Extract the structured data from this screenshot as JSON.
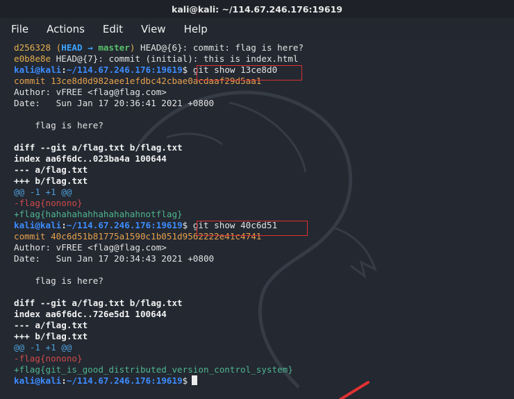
{
  "window": {
    "title": "kali@kali: ~/114.67.246.176:19619"
  },
  "menu": [
    "File",
    "Actions",
    "Edit",
    "View",
    "Help"
  ],
  "terminal": {
    "reflog1": {
      "hash": "d256328",
      "open": " (",
      "head": "HEAD",
      "arrow": " → ",
      "branch": "master",
      "close": ")",
      "rest": " HEAD@{6}: commit: flag is here?"
    },
    "reflog2": {
      "hash": "e0b8e8e",
      "rest": " HEAD@{7}: commit (initial): this is index.html"
    },
    "prompt": {
      "user": "kali@kali",
      "sep": ":",
      "path": "~/114.67.246.176:19619",
      "dollar": "$"
    },
    "cmd1": " git show 13ce8d0",
    "show1": {
      "commit": "commit 13ce8d0d982aee1efdbc42cbae0acdaaf29d5aa1",
      "author": "Author: vFREE <flag@flag.com>",
      "date": "Date:   Sun Jan 17 20:36:41 2021 +0800",
      "message": "    flag is here?",
      "diff": "diff --git a/flag.txt b/flag.txt",
      "index": "index aa6f6dc..023ba4a 100644",
      "minus_file": "--- a/flag.txt",
      "plus_file": "+++ b/flag.txt",
      "hunk": "@@ -1 +1 @@",
      "removed": "-flag{nonono}",
      "added": "+flag{hahahahahhahahahahnotflag}"
    },
    "cmd2": " git show 40c6d51",
    "show2": {
      "commit": "commit 40c6d51b81775a1590c1b051d9562222e41c4741",
      "author": "Author: vFREE <flag@flag.com>",
      "date": "Date:   Sun Jan 17 20:34:43 2021 +0800",
      "message": "    flag is here?",
      "diff": "diff --git a/flag.txt b/flag.txt",
      "index": "index aa6f6dc..726e5d1 100644",
      "minus_file": "--- a/flag.txt",
      "plus_file": "+++ b/flag.txt",
      "hunk": "@@ -1 +1 @@",
      "removed": "-flag{nonono}",
      "added": "+flag{git_is_good_distributed_version_control_system}"
    }
  },
  "colors": {
    "highlight_box": "#e03131",
    "arrow": "#e03131",
    "prompt": "#3d8cff"
  }
}
